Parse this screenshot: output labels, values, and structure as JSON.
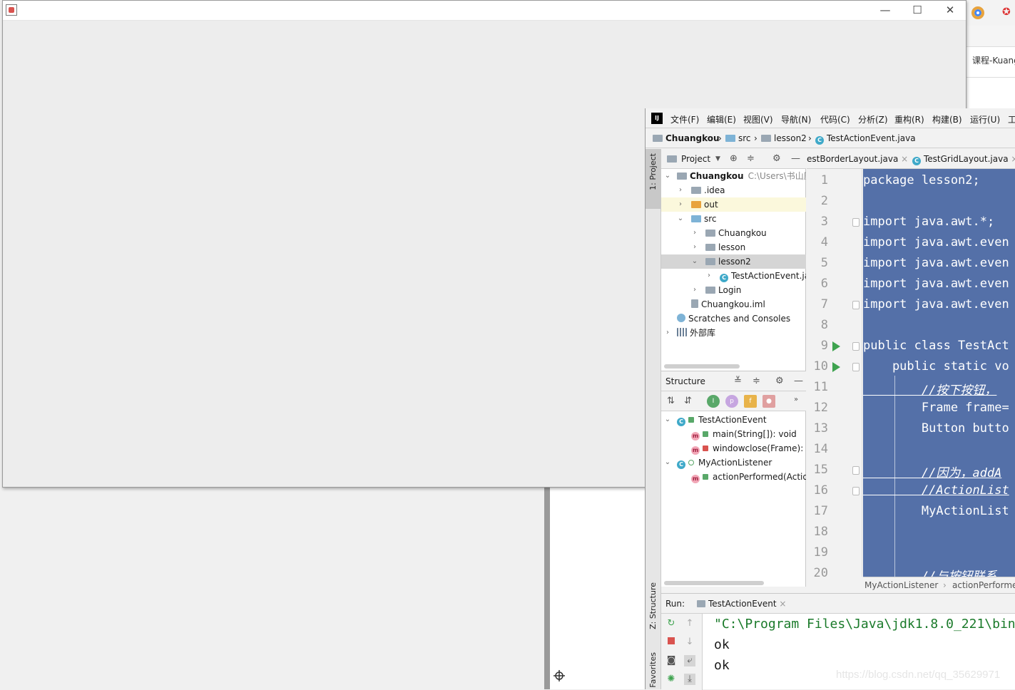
{
  "browser": {
    "tab_text": "课程-Kuang"
  },
  "jframe": {
    "minimize": "—",
    "maximize": "☐",
    "close": "✕"
  },
  "ide": {
    "logo": "IJ",
    "menu": [
      "文件(F)",
      "编辑(E)",
      "视图(V)",
      "导航(N)",
      "代码(C)",
      "分析(Z)",
      "重构(R)",
      "构建(B)",
      "运行(U)",
      "工"
    ],
    "nav": {
      "project": "Chuangkou",
      "src": "src",
      "package": "lesson2",
      "file": "TestActionEvent.java"
    },
    "stripe": {
      "project": "1: Project",
      "structure": "Z: Structure",
      "favorites": "Favorites"
    },
    "project_panel": {
      "title": "Project",
      "root_name": "Chuangkou",
      "root_path": "C:\\Users\\书山压",
      "items": {
        "idea": ".idea",
        "out": "out",
        "src": "src",
        "chuangkou": "Chuangkou",
        "lesson": "lesson",
        "lesson2": "lesson2",
        "testactionevent": "TestActionEvent.ja",
        "login": "Login",
        "iml": "Chuangkou.iml",
        "scratches": "Scratches and Consoles",
        "external": "外部库"
      }
    },
    "structure_panel": {
      "title": "Structure",
      "items": {
        "class1": "TestActionEvent",
        "main": "main(String[]): void",
        "windowclose": "windowclose(Frame): v",
        "class2": "MyActionListener",
        "action": "actionPerformed(Actio"
      }
    },
    "editor_tabs": {
      "tab1": "estBorderLayout.java",
      "tab2": "TestGridLayout.java"
    },
    "line_numbers": [
      "1",
      "2",
      "3",
      "4",
      "5",
      "6",
      "7",
      "8",
      "9",
      "10",
      "11",
      "12",
      "13",
      "14",
      "15",
      "16",
      "17",
      "18",
      "19",
      "20"
    ],
    "code": {
      "l1": "package lesson2;",
      "l3": "import java.awt.*;",
      "l4": "import java.awt.even",
      "l5": "import java.awt.even",
      "l6": "import java.awt.even",
      "l7": "import java.awt.even",
      "l9": "public class TestAct",
      "l10": "    public static vo",
      "l11": "        //按下按钮，",
      "l12": "        Frame frame=",
      "l13": "        Button butto",
      "l15": "        //因为，addA",
      "l16": "        //ActionList",
      "l17": "        MyActionList",
      "l20": "        //与按钮联系"
    },
    "breadcrumb": {
      "class": "MyActionListener",
      "method": "actionPerforme"
    },
    "run": {
      "label": "Run:",
      "tab": "TestActionEvent",
      "lines": [
        "\"C:\\Program Files\\Java\\jdk1.8.0_221\\bin",
        "ok",
        "ok"
      ]
    }
  },
  "watermark": "https://blog.csdn.net/qq_35629971"
}
